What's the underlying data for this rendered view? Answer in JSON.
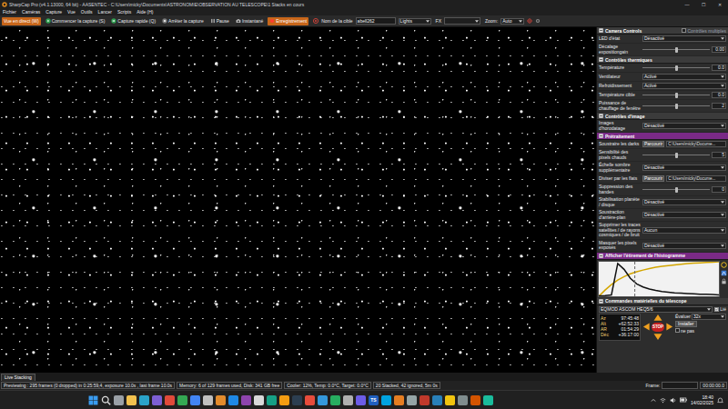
{
  "window": {
    "title": "SharpCap Pro (v4.1.13000, 64 bit) - AASENTEC - C:\\Users\\micky\\Documents\\ASTRONOMIE\\OBSERVATION AU TELESCOPE\\1 Stacks en cours",
    "controls": [
      "—",
      "☐",
      "✕"
    ]
  },
  "menu": [
    "Fichier",
    "Caméras",
    "Capture",
    "Vue",
    "Outils",
    "Lancer",
    "Scripts",
    "Aide (H)"
  ],
  "toolbar": {
    "buttons": [
      {
        "label": "Vue en direct (W)",
        "selected": true
      },
      {
        "label": "Commencer la capture (S)",
        "selected": false
      },
      {
        "label": "Capture rapide (Q)",
        "selected": false
      },
      {
        "label": "Arrêter la capture",
        "selected": false
      },
      {
        "label": "Pause",
        "selected": false
      },
      {
        "label": "Instantané",
        "selected": false
      },
      {
        "label": "Enregistrement",
        "selected": true
      }
    ],
    "target_label": "Nom de la cible",
    "target": "abell262",
    "frame_type": "Lights",
    "fx_label": "FX",
    "zoom_label": "Zoom:",
    "zoom": "Auto"
  },
  "panel": {
    "sections": [
      {
        "title": "Camera Controls",
        "highlighted": false,
        "checkbox": {
          "label": "Contrôles multiples",
          "checked": false
        },
        "rows": [
          {
            "kind": "select",
            "label": "LED d'état",
            "value": "Désactivé"
          },
          {
            "kind": "slider",
            "label": "Décalage expositiongain",
            "value": "0.00",
            "level": 0.5
          }
        ]
      },
      {
        "title": "Contrôles thermiques",
        "highlighted": false,
        "rows": [
          {
            "kind": "slider",
            "label": "Température",
            "value": "0.0",
            "level": 0.5
          },
          {
            "kind": "select",
            "label": "Ventilateur",
            "value": "Activé"
          },
          {
            "kind": "select",
            "label": "Refroidissement",
            "value": "Activé"
          },
          {
            "kind": "slider",
            "label": "Température cible",
            "value": "0.0",
            "level": 0.5
          },
          {
            "kind": "slider",
            "label": "Puissance de chauffage de fenêtre",
            "value": "2",
            "level": 0.5
          }
        ]
      },
      {
        "title": "Contrôles d'image",
        "highlighted": false,
        "rows": [
          {
            "kind": "select",
            "label": "Images d'horodatage",
            "value": "Désactivé"
          }
        ]
      },
      {
        "title": "Prétraitement",
        "highlighted": true,
        "rows": [
          {
            "kind": "file",
            "label": "Soustraire les darks",
            "button": "Parcourir",
            "value": "C:\\Users\\micky\\Docume..."
          },
          {
            "kind": "slider",
            "label": "Sensibilité des pixels chauds",
            "value": "5",
            "level": 0.5
          },
          {
            "kind": "select",
            "label": "Échelle sombre supplémentaire",
            "value": "Désactivé"
          },
          {
            "kind": "file",
            "label": "Diviser par les flats",
            "button": "Parcourir",
            "value": "C:\\Users\\micky\\Docume..."
          },
          {
            "kind": "slider",
            "label": "Suppression des bandes",
            "value": "0",
            "level": 0.5
          },
          {
            "kind": "select",
            "label": "Stabilisation planète / disque",
            "value": "Désactivé"
          },
          {
            "kind": "select",
            "label": "Soustraction d'arrière-plan",
            "value": "Désactivé"
          },
          {
            "kind": "select",
            "label": "Supprimer les traces satellites / de rayons cosmiques / de bruit",
            "value": "Aucun"
          },
          {
            "kind": "select",
            "label": "Masquer les pixels exposés",
            "value": "Désactivé"
          }
        ]
      }
    ]
  },
  "histogram": {
    "title": "Afficher l'étirement de l'histogramme",
    "highlighted": true,
    "values": [
      1,
      2,
      4,
      95,
      78,
      52,
      36,
      27,
      21,
      17,
      14,
      12,
      10,
      9,
      8,
      7,
      6,
      6,
      5,
      4
    ],
    "stretch": [
      0,
      18,
      34,
      47,
      57,
      65,
      71,
      76,
      80,
      84,
      87,
      89,
      91,
      93,
      95,
      96,
      97,
      98,
      99,
      100
    ],
    "marker_level": 0.3
  },
  "telescope": {
    "title": "Commandes matérielles du télescope",
    "highlighted": false,
    "device": "EQMOD ASCOM HEQ5/6",
    "linked": {
      "label": "Lié",
      "checked": true
    },
    "coords": [
      {
        "label": "Az",
        "value": "97:45:48"
      },
      {
        "label": "Alt",
        "value": "+62:52:33"
      },
      {
        "label": "AR",
        "value": "01:54:29"
      },
      {
        "label": "Déc",
        "value": "+36:17:00"
      }
    ],
    "stop": "STOP",
    "rate_label": "Évaluer",
    "rate": "32x",
    "setup": "Installer",
    "option": {
      "label": "ne pas",
      "checked": false
    }
  },
  "bottom_tab": {
    "label": "Live Stacking"
  },
  "status_bar": {
    "items": [
      "Previewing : 295 frames (0 dropped) in 0:25:59,4, exposure 10.0s , last frame 10.0s",
      "Memory: 6 of 129 frames used, Disk: 341 GB free",
      "Cooler: 12%, Temp: 0.0°C, Target: 0.0°C",
      "20 Stacked, 42 ignored, 5m 0s"
    ],
    "frame_label": "Frame:",
    "frame_value": "00:00:00.0"
  },
  "taskbar": {
    "apps": [
      {
        "color": "#9aa0a6"
      },
      {
        "color": "#f2c14e"
      },
      {
        "color": "#2aa3c9"
      },
      {
        "color": "#7d5fd3"
      },
      {
        "color": "#e04a3a"
      },
      {
        "color": "#34a853"
      },
      {
        "color": "#4285f4"
      },
      {
        "color": "#c0c0c0"
      },
      {
        "color": "#e38b2c"
      },
      {
        "color": "#1e88e5"
      },
      {
        "color": "#8e44ad"
      },
      {
        "color": "#d9d9d9"
      },
      {
        "color": "#16a085"
      },
      {
        "color": "#f39c12"
      },
      {
        "color": "#2c3e50"
      },
      {
        "color": "#e74c3c"
      },
      {
        "color": "#3498db"
      },
      {
        "color": "#27ae60"
      },
      {
        "color": "#b0b0b0"
      },
      {
        "color": "#6c5ce7"
      },
      {
        "color": "#1f5fbf",
        "label": "TS"
      },
      {
        "color": "#00a3e0"
      },
      {
        "color": "#e67e22"
      },
      {
        "color": "#95a5a6"
      },
      {
        "color": "#c0392b"
      },
      {
        "color": "#2980b9"
      },
      {
        "color": "#f1c40f"
      },
      {
        "color": "#7f8c8d"
      },
      {
        "color": "#d35400"
      },
      {
        "color": "#1abc9c"
      }
    ],
    "time": "18:40",
    "date": "14/02/2025"
  }
}
